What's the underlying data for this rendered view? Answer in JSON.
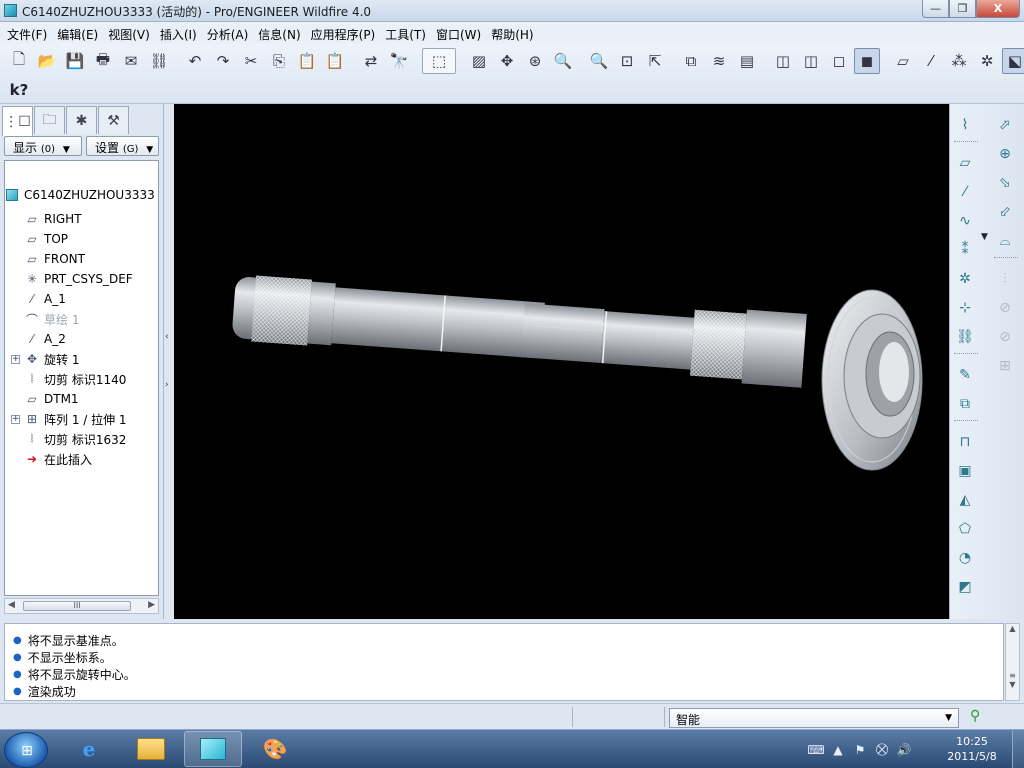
{
  "window": {
    "title": "C6140ZHUZHOU3333 (活动的) - Pro/ENGINEER Wildfire 4.0",
    "minimize": "—",
    "maximize": "❐",
    "close": "X"
  },
  "menu": [
    "文件(F)",
    "编辑(E)",
    "视图(V)",
    "插入(I)",
    "分析(A)",
    "信息(N)",
    "应用程序(P)",
    "工具(T)",
    "窗口(W)",
    "帮助(H)"
  ],
  "toolbar": {
    "whats_this": "k?",
    "icons": [
      {
        "name": "new-icon",
        "glyph": "🗋"
      },
      {
        "name": "open-icon",
        "glyph": "📂"
      },
      {
        "name": "save-icon",
        "glyph": "💾"
      },
      {
        "name": "print-icon",
        "glyph": "🖶"
      },
      {
        "name": "send-mail-icon",
        "glyph": "✉"
      },
      {
        "name": "send-link-icon",
        "glyph": "⛓"
      },
      {
        "name": "undo-icon",
        "glyph": "↶"
      },
      {
        "name": "redo-icon",
        "glyph": "↷"
      },
      {
        "name": "cut-icon",
        "glyph": "✂"
      },
      {
        "name": "copy-icon",
        "glyph": "⎘"
      },
      {
        "name": "paste-icon",
        "glyph": "📋"
      },
      {
        "name": "paste-special-icon",
        "glyph": "📋"
      },
      {
        "name": "regenerate-icon",
        "glyph": "⇄"
      },
      {
        "name": "find-icon",
        "glyph": "🔭"
      },
      {
        "name": "select-box-icon",
        "glyph": "⬚"
      },
      {
        "name": "repaint-icon",
        "glyph": "▨"
      },
      {
        "name": "spin-center-icon",
        "glyph": "✥"
      },
      {
        "name": "orient-mode-icon",
        "glyph": "⊛"
      },
      {
        "name": "zoom-in-icon",
        "glyph": "🔍"
      },
      {
        "name": "zoom-out-icon",
        "glyph": "🔍"
      },
      {
        "name": "refit-icon",
        "glyph": "⊡"
      },
      {
        "name": "reorient-icon",
        "glyph": "⇱"
      },
      {
        "name": "saved-views-icon",
        "glyph": "⧉"
      },
      {
        "name": "layers-icon",
        "glyph": "≋"
      },
      {
        "name": "view-manager-icon",
        "glyph": "▤"
      },
      {
        "name": "wireframe-icon",
        "glyph": "◫"
      },
      {
        "name": "hidden-line-icon",
        "glyph": "◫"
      },
      {
        "name": "no-hidden-icon",
        "glyph": "◻"
      },
      {
        "name": "shading-icon",
        "glyph": "◼"
      },
      {
        "name": "datum-planes-icon",
        "glyph": "▱"
      },
      {
        "name": "datum-axes-icon",
        "glyph": "⁄"
      },
      {
        "name": "datum-points-icon",
        "glyph": "⁂"
      },
      {
        "name": "coordinate-systems-icon",
        "glyph": "✲"
      },
      {
        "name": "annotation-display-icon",
        "glyph": "⬕"
      }
    ]
  },
  "left_panel": {
    "tabs": [
      "model-tree-icon",
      "folder-browser-icon",
      "favorites-icon",
      "connections-icon"
    ],
    "show_label": "显示",
    "show_key": "(0)",
    "settings_label": "设置",
    "settings_key": "(G)",
    "root": "C6140ZHUZHOU3333.PRT",
    "tree": [
      {
        "label": "RIGHT",
        "icon": "datum-plane-icon",
        "glyph": "▱",
        "expandable": false,
        "dim": false
      },
      {
        "label": "TOP",
        "icon": "datum-plane-icon",
        "glyph": "▱",
        "expandable": false,
        "dim": false
      },
      {
        "label": "FRONT",
        "icon": "datum-plane-icon",
        "glyph": "▱",
        "expandable": false,
        "dim": false
      },
      {
        "label": "PRT_CSYS_DEF",
        "icon": "coordinate-system-icon",
        "glyph": "✳",
        "expandable": false,
        "dim": false
      },
      {
        "label": "A_1",
        "icon": "datum-axis-icon",
        "glyph": "⁄",
        "expandable": false,
        "dim": false
      },
      {
        "label": "草绘 1",
        "icon": "sketch-icon",
        "glyph": "⌒",
        "expandable": false,
        "dim": true
      },
      {
        "label": "A_2",
        "icon": "datum-axis-icon",
        "glyph": "⁄",
        "expandable": false,
        "dim": false
      },
      {
        "label": "旋转 1",
        "icon": "revolve-icon",
        "glyph": "✥",
        "expandable": true,
        "dim": false
      },
      {
        "label": "切剪 标识1140",
        "icon": "cut-icon",
        "glyph": "⦚",
        "expandable": false,
        "dim": false
      },
      {
        "label": "DTM1",
        "icon": "datum-plane-icon",
        "glyph": "▱",
        "expandable": false,
        "dim": false
      },
      {
        "label": "阵列 1 / 拉伸 1",
        "icon": "pattern-icon",
        "glyph": "⊞",
        "expandable": true,
        "dim": false
      },
      {
        "label": "切剪 标识1632",
        "icon": "cut-icon",
        "glyph": "⦚",
        "expandable": false,
        "dim": false
      },
      {
        "label": "在此插入",
        "icon": "insert-here-icon",
        "glyph": "➜",
        "expandable": false,
        "dim": false
      }
    ],
    "scroll_thumb": "III",
    "scroll_left": "◀",
    "scroll_right": "▶"
  },
  "right_toolbar": {
    "col1": [
      {
        "name": "datum-plane-tool-icon",
        "glyph": "⌇",
        "dim": false
      },
      "sep",
      {
        "name": "plane-tool-icon",
        "glyph": "▱",
        "dim": false
      },
      {
        "name": "axis-tool-icon",
        "glyph": "⁄",
        "dim": false
      },
      {
        "name": "curve-tool-icon",
        "glyph": "∿",
        "dim": false
      },
      {
        "name": "point-tool-icon",
        "glyph": "⁑",
        "dim": false
      },
      {
        "name": "csys-tool-icon",
        "glyph": "✲",
        "dim": false
      },
      {
        "name": "analysis-feature-icon",
        "glyph": "⊹",
        "dim": false
      },
      {
        "name": "insert-ud-feature-icon",
        "glyph": "⛓",
        "dim": false
      },
      "sep",
      {
        "name": "sketch-tool-icon",
        "glyph": "✎",
        "dim": false
      },
      {
        "name": "copy-feature-icon",
        "glyph": "⧉",
        "dim": false
      },
      "sep",
      {
        "name": "hole-tool-icon",
        "glyph": "⊓",
        "dim": false
      },
      {
        "name": "shell-tool-icon",
        "glyph": "▣",
        "dim": false
      },
      {
        "name": "rib-tool-icon",
        "glyph": "◭",
        "dim": false
      },
      {
        "name": "draft-tool-icon",
        "glyph": "⬠",
        "dim": false
      },
      {
        "name": "round-tool-icon",
        "glyph": "◔",
        "dim": false
      },
      {
        "name": "chamfer-tool-icon",
        "glyph": "◩",
        "dim": false
      }
    ],
    "col2": [
      {
        "name": "extrude-tool-icon",
        "glyph": "⬀",
        "dim": false
      },
      {
        "name": "revolve-tool-icon",
        "glyph": "⊕",
        "dim": false
      },
      {
        "name": "sweep-tool-icon",
        "glyph": "⬂",
        "dim": false
      },
      {
        "name": "blend-tool-icon",
        "glyph": "⬃",
        "dim": false
      },
      {
        "name": "boundary-tool-icon",
        "glyph": "⌓",
        "dim": false
      },
      "sep",
      {
        "name": "mirror-tool-icon",
        "glyph": "⫶",
        "dim": true
      },
      {
        "name": "merge-tool-icon",
        "glyph": "⊘",
        "dim": true
      },
      {
        "name": "trim-tool-icon",
        "glyph": "⊘",
        "dim": true
      },
      {
        "name": "pattern-tool-icon",
        "glyph": "⊞",
        "dim": true
      }
    ],
    "more_arrow": "▼"
  },
  "messages": [
    "将不显示基准点。",
    "不显示坐标系。",
    "将不显示旋转中心。",
    "渲染成功"
  ],
  "message_scroll": {
    "up": "▲",
    "down": "▼",
    "grip": "≡"
  },
  "status": {
    "filter_value": "智能",
    "filter_arrow": "▼",
    "light": "⚲"
  },
  "taskbar": {
    "start_glyph": "⊞",
    "ie_glyph": "e",
    "tray": [
      "⌨",
      "▲",
      "⚑",
      "⛒",
      "🔊"
    ],
    "time": "10:25",
    "date": "2011/5/8"
  },
  "colors": {
    "viewport_bg": "#000000",
    "part_body": "#b9bdc3",
    "accent": "#1b63c6"
  }
}
